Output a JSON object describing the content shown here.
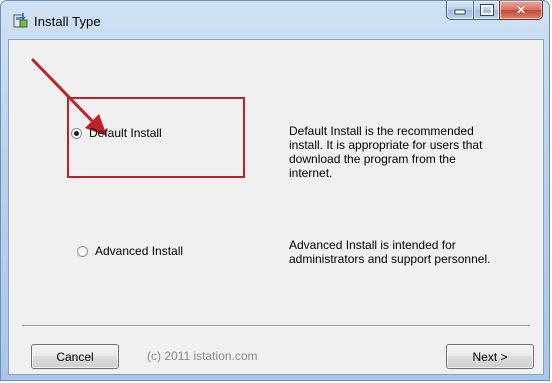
{
  "window": {
    "title": "Install Type",
    "icon": "installer-icon",
    "caption_buttons": [
      "minimize-icon",
      "maximize-icon",
      "close-icon"
    ]
  },
  "options": [
    {
      "label": "Default Install",
      "selected": true,
      "description": [
        "Default Install is the recommended",
        "install. It is appropriate for users that",
        "download the program from the",
        "internet."
      ]
    },
    {
      "label": "Advanced Install",
      "selected": false,
      "description": [
        "Advanced Install is intended for",
        "administrators and support personnel."
      ]
    }
  ],
  "annotation": {
    "color": "#c0202a",
    "icon": "arrow-icon"
  },
  "footer": {
    "cancel_label": "Cancel",
    "copyright": "(c) 2011 istation.com",
    "next_label": "Next >"
  }
}
